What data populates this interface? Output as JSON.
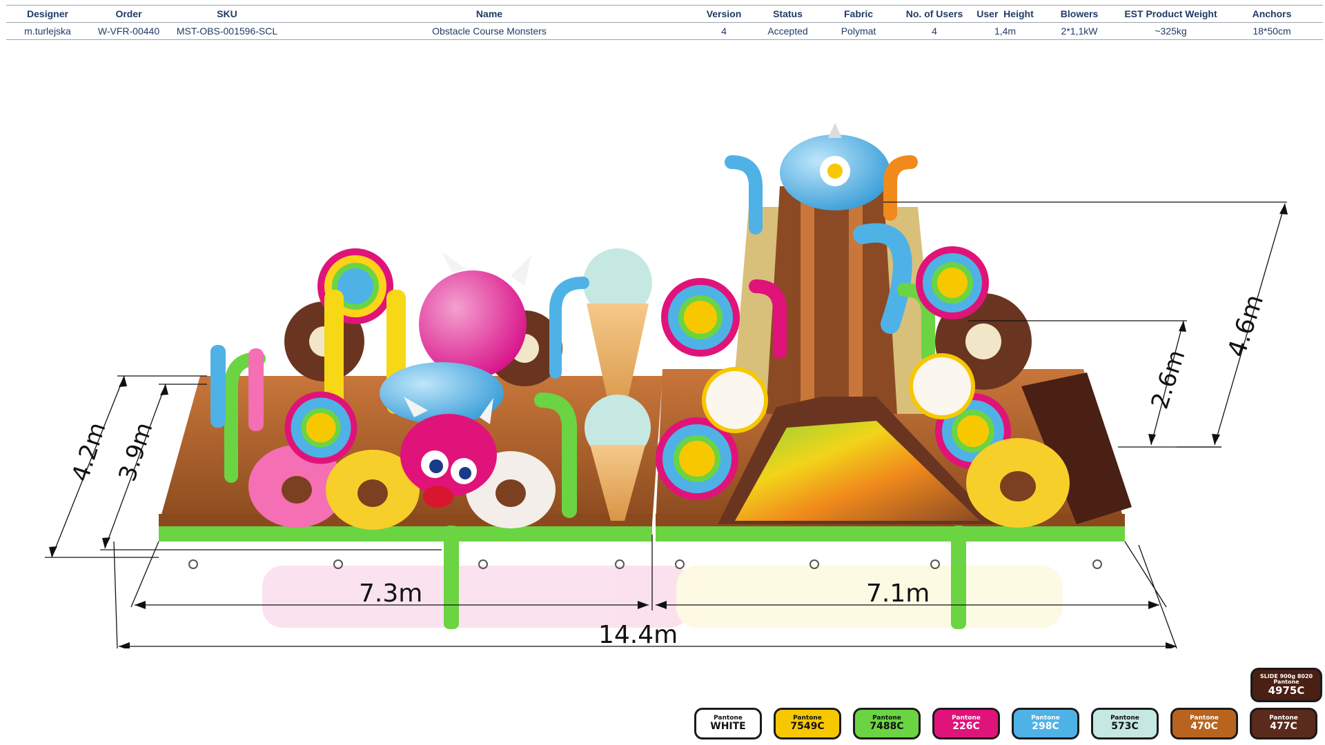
{
  "table": {
    "headers": {
      "designer": "Designer",
      "order": "Order",
      "sku": "SKU",
      "name": "Name",
      "version": "Version",
      "status": "Status",
      "fabric": "Fabric",
      "users": "No. of Users",
      "height": "User  Height",
      "blowers": "Blowers",
      "weight": "EST Product Weight",
      "anchors": "Anchors"
    },
    "row": {
      "designer": "m.turlejska",
      "order": "W-VFR-00440",
      "sku": "MST-OBS-001596-SCL",
      "name": "Obstacle Course Monsters",
      "version": "4",
      "status": "Accepted",
      "fabric": "Polymat",
      "users": "4",
      "height": "1,4m",
      "blowers": "2*1,1kW",
      "weight": "~325kg",
      "anchors": "18*50cm"
    }
  },
  "dimensions": {
    "left_depth_outer": "4.2m",
    "left_depth_inner": "3.9m",
    "left_length": "7.3m",
    "right_length": "7.1m",
    "total_length": "14.4m",
    "slide_height": "2.6m",
    "max_height": "4.6m"
  },
  "pantone": {
    "swatches": [
      {
        "label": "Pantone",
        "code": "WHITE",
        "color": "#ffffff"
      },
      {
        "label": "Pantone",
        "code": "7549C",
        "color": "#f7c800"
      },
      {
        "label": "Pantone",
        "code": "7488C",
        "color": "#6bd442"
      },
      {
        "label": "Pantone",
        "code": "226C",
        "color": "#e0137a"
      },
      {
        "label": "Pantone",
        "code": "298C",
        "color": "#4fb2e6"
      },
      {
        "label": "Pantone",
        "code": "573C",
        "color": "#c6e8e2"
      },
      {
        "label": "Pantone",
        "code": "470C",
        "color": "#b8641f"
      },
      {
        "label": "Pantone",
        "code": "477C",
        "color": "#5a2a1c"
      }
    ],
    "slide_swatch": {
      "line1": "SLIDE 900g 8020",
      "line2": "Pantone",
      "code": "4975C",
      "color": "#4a1f14"
    }
  }
}
